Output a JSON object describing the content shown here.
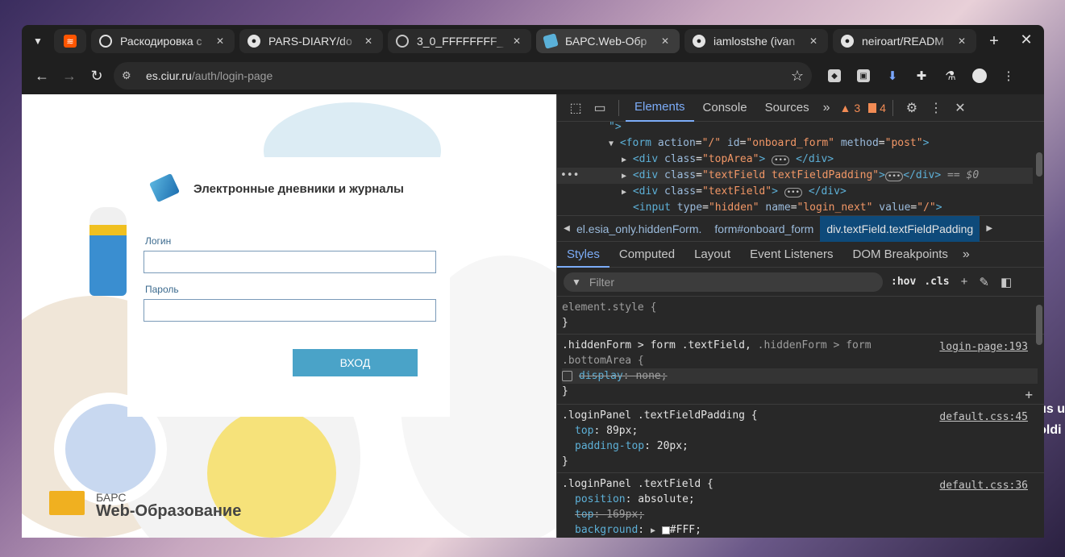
{
  "desktop": {
    "fragment1": "us u",
    "fragment2": "oldi"
  },
  "tabs": [
    {
      "title": "",
      "icon": "soundcloud-icon",
      "pinned": true
    },
    {
      "title": "Раскодировка с",
      "icon": "openai-icon"
    },
    {
      "title": "PARS-DIARY/do",
      "icon": "github-icon"
    },
    {
      "title": "3_0_FFFFFFFF_",
      "icon": "globe-icon"
    },
    {
      "title": "БАРС.Web-Обр",
      "icon": "bars-icon",
      "active": true
    },
    {
      "title": "iamlostshe (ivan",
      "icon": "github-icon"
    },
    {
      "title": "neiroart/READM",
      "icon": "github-icon"
    }
  ],
  "toolbar": {
    "url_host": "es.ciur.ru",
    "url_path": "/auth/login-page"
  },
  "page": {
    "title": "Электронные дневники и журналы",
    "login_label": "Логин",
    "password_label": "Пароль",
    "login_button": "ВХОД",
    "brand_small": "БАРС",
    "brand_big": "Web-Образование"
  },
  "devtools": {
    "tabs": [
      "Elements",
      "Console",
      "Sources"
    ],
    "active_tab": "Elements",
    "warnings_count": "3",
    "issues_count": "4",
    "dom": {
      "line0": "\">",
      "form_open_tag": "<form",
      "form_action_attr": "action",
      "form_action_val": "\"/\"",
      "form_id_attr": "id",
      "form_id_val": "\"onboard_form\"",
      "form_method_attr": "method",
      "form_method_val": "\"post\"",
      "div_tag": "<div",
      "div_close": "</div>",
      "class_attr": "class",
      "topArea_val": "\"topArea\"",
      "textFieldPadding_val": "\"textField textFieldPadding\"",
      "textField_val": "\"textField\"",
      "eq_hint": "== $0",
      "input_tag": "<input",
      "type_attr": "type",
      "type_val": "\"hidden\"",
      "name_attr": "name",
      "name_val": "\"login_next\"",
      "value_attr": "value",
      "value_val": "\"/\"",
      "gt": ">",
      "close_gt": "\">"
    },
    "breadcrumbs": [
      "el.esia_only.hiddenForm.",
      "form#onboard_form",
      "div.textField.textFieldPadding"
    ],
    "sub_tabs": [
      "Styles",
      "Computed",
      "Layout",
      "Event Listeners",
      "DOM Breakpoints"
    ],
    "filter_placeholder": "Filter",
    "hov": ":hov",
    "cls": ".cls",
    "styles": {
      "element_style": "element.style {",
      "close_brace": "}",
      "rule1_selector": ".hiddenForm > form .textField,",
      "rule1_selector_dim": ".hiddenForm > form",
      "rule1_selector_dim2": ".bottomArea {",
      "rule1_source": "login-page:193",
      "rule1_prop": "display",
      "rule1_val": "none;",
      "rule2_selector": ".loginPanel .textFieldPadding {",
      "rule2_source": "default.css:45",
      "rule2_p1": "top",
      "rule2_v1": "89px;",
      "rule2_p2": "padding-top",
      "rule2_v2": "20px;",
      "rule3_selector": ".loginPanel .textField {",
      "rule3_source": "default.css:36",
      "rule3_p1": "position",
      "rule3_v1": "absolute;",
      "rule3_p2": "top",
      "rule3_v2": "169px;",
      "rule3_p3": "background",
      "rule3_v3": "#FFF;"
    }
  }
}
